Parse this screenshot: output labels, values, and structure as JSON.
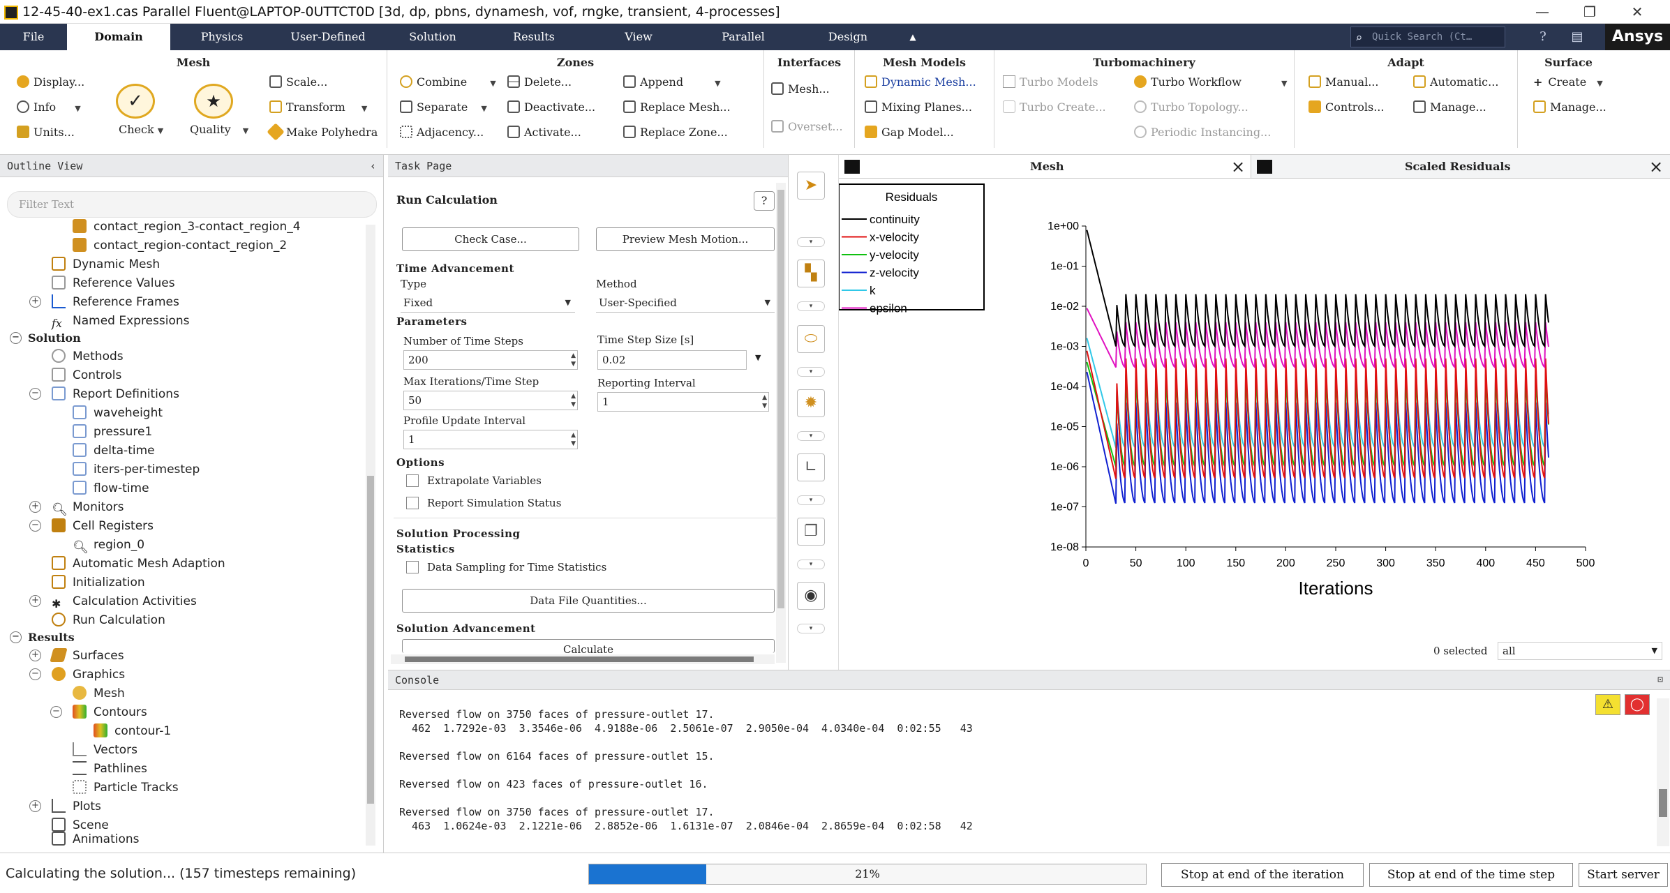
{
  "window": {
    "title": "12-45-40-ex1.cas Parallel Fluent@LAPTOP-0UTTCT0D  [3d, dp, pbns, dynamesh, vof, rngke, transient, 4-processes]"
  },
  "menu": {
    "tabs": [
      "File",
      "Domain",
      "Physics",
      "User-Defined",
      "Solution",
      "Results",
      "View",
      "Parallel",
      "Design"
    ],
    "active": "Domain",
    "search_placeholder": "Quick Search (Ct…",
    "brand": "Ansys"
  },
  "ribbon": {
    "mesh": {
      "title": "Mesh",
      "display": "Display...",
      "info": "Info",
      "units": "Units...",
      "check": "Check",
      "quality": "Quality",
      "scale": "Scale...",
      "transform": "Transform",
      "make_polyhedra": "Make Polyhedra"
    },
    "zones": {
      "title": "Zones",
      "combine": "Combine",
      "separate": "Separate",
      "adjacency": "Adjacency...",
      "delete": "Delete...",
      "deactivate": "Deactivate...",
      "activate": "Activate...",
      "append": "Append",
      "replace_mesh": "Replace Mesh...",
      "replace_zone": "Replace Zone..."
    },
    "interfaces": {
      "title": "Interfaces",
      "mesh": "Mesh...",
      "overset": "Overset..."
    },
    "mesh_models": {
      "title": "Mesh Models",
      "dynamic_mesh": "Dynamic Mesh...",
      "mixing_planes": "Mixing Planes...",
      "gap_model": "Gap Model..."
    },
    "turbomachinery": {
      "title": "Turbomachinery",
      "turbo_models": "Turbo Models",
      "turbo_workflow": "Turbo Workflow",
      "turbo_create": "Turbo Create...",
      "turbo_topology": "Turbo Topology...",
      "periodic_instancing": "Periodic Instancing..."
    },
    "adapt": {
      "title": "Adapt",
      "manual": "Manual...",
      "automatic": "Automatic...",
      "controls": "Controls...",
      "manage": "Manage..."
    },
    "surface": {
      "title": "Surface",
      "create": "Create",
      "manage": "Manage..."
    }
  },
  "outline": {
    "title": "Outline View",
    "filter_placeholder": "Filter Text",
    "items": [
      {
        "label": "contact_region_3-contact_region_4"
      },
      {
        "label": "contact_region-contact_region_2"
      },
      {
        "label": "Dynamic Mesh"
      },
      {
        "label": "Reference Values"
      },
      {
        "label": "Reference Frames"
      },
      {
        "label": "Named Expressions"
      },
      {
        "label": "Solution"
      },
      {
        "label": "Methods"
      },
      {
        "label": "Controls"
      },
      {
        "label": "Report Definitions"
      },
      {
        "label": "waveheight"
      },
      {
        "label": "pressure1"
      },
      {
        "label": "delta-time"
      },
      {
        "label": "iters-per-timestep"
      },
      {
        "label": "flow-time"
      },
      {
        "label": "Monitors"
      },
      {
        "label": "Cell Registers"
      },
      {
        "label": "region_0"
      },
      {
        "label": "Automatic Mesh Adaption"
      },
      {
        "label": "Initialization"
      },
      {
        "label": "Calculation Activities"
      },
      {
        "label": "Run Calculation"
      },
      {
        "label": "Results"
      },
      {
        "label": "Surfaces"
      },
      {
        "label": "Graphics"
      },
      {
        "label": "Mesh"
      },
      {
        "label": "Contours"
      },
      {
        "label": "contour-1"
      },
      {
        "label": "Vectors"
      },
      {
        "label": "Pathlines"
      },
      {
        "label": "Particle Tracks"
      },
      {
        "label": "Plots"
      },
      {
        "label": "Scene"
      },
      {
        "label": "Animations"
      }
    ]
  },
  "task": {
    "header": "Task Page",
    "title": "Run Calculation",
    "check_case": "Check Case...",
    "preview_mesh": "Preview Mesh Motion...",
    "time_advancement": "Time Advancement",
    "type_label": "Type",
    "type_value": "Fixed",
    "method_label": "Method",
    "method_value": "User-Specified",
    "parameters": "Parameters",
    "n_steps_label": "Number of Time Steps",
    "n_steps": "200",
    "step_size_label": "Time Step Size [s]",
    "step_size": "0.02",
    "max_iter_label": "Max Iterations/Time Step",
    "max_iter": "50",
    "report_interval_label": "Reporting Interval",
    "report_interval": "1",
    "profile_interval_label": "Profile Update Interval",
    "profile_interval": "1",
    "options": "Options",
    "extrapolate": "Extrapolate Variables",
    "report_status": "Report Simulation Status",
    "solution_processing": "Solution Processing",
    "statistics": "Statistics",
    "data_sampling": "Data Sampling for Time Statistics",
    "data_file_quantities": "Data File Quantities...",
    "solution_advancement": "Solution Advancement",
    "calculate": "Calculate"
  },
  "graphics": {
    "mesh_tab": "Mesh",
    "residuals_tab": "Scaled Residuals",
    "selected": "0 selected",
    "filter_value": "all"
  },
  "chart_data": {
    "type": "line",
    "title": "",
    "xlabel": "Iterations",
    "ylabel": "",
    "xlim": [
      0,
      500
    ],
    "ylim": [
      1e-08,
      1
    ],
    "yscale": "log",
    "xticks": [
      "0",
      "50",
      "100",
      "150",
      "200",
      "250",
      "300",
      "350",
      "400",
      "450",
      "500"
    ],
    "yticks": [
      "1e+00",
      "1e-01",
      "1e-02",
      "1e-03",
      "1e-04",
      "1e-05",
      "1e-06",
      "1e-07",
      "1e-08"
    ],
    "legend_title": "Residuals",
    "legend_position": "top-left",
    "series": [
      {
        "name": "continuity",
        "color": "#000000",
        "start": 1.0,
        "settle_at": 30,
        "peak": 0.02,
        "trough": 0.001
      },
      {
        "name": "x-velocity",
        "color": "#e01010",
        "start": 0.001,
        "settle_at": 30,
        "peak": 0.0005,
        "trough": 5e-07
      },
      {
        "name": "y-velocity",
        "color": "#10c010",
        "start": 0.0005,
        "settle_at": 30,
        "peak": 0.0002,
        "trough": 1e-06
      },
      {
        "name": "z-velocity",
        "color": "#1020d0",
        "start": 0.0003,
        "settle_at": 30,
        "peak": 4e-05,
        "trough": 1.2e-07
      },
      {
        "name": "k",
        "color": "#30c8e8",
        "start": 0.002,
        "settle_at": 30,
        "peak": 0.0002,
        "trough": 3e-06
      },
      {
        "name": "epsilon",
        "color": "#e010c0",
        "start": 0.01,
        "settle_at": 30,
        "peak": 0.004,
        "trough": 0.0003
      }
    ],
    "cycle_length": 10,
    "last_iteration": 463
  },
  "console": {
    "title": "Console",
    "lines": [
      "Reversed flow on 3750 faces of pressure-outlet 17.",
      "  462  1.7292e-03  3.3546e-06  4.9188e-06  2.5061e-07  2.9050e-04  4.0340e-04  0:02:55   43",
      "",
      "Reversed flow on 6164 faces of pressure-outlet 15.",
      "",
      "Reversed flow on 423 faces of pressure-outlet 16.",
      "",
      "Reversed flow on 3750 faces of pressure-outlet 17.",
      "  463  1.0624e-03  2.1221e-06  2.8852e-06  1.6131e-07  2.0846e-04  2.8659e-04  0:02:58   42"
    ]
  },
  "status": {
    "text": "Calculating the solution... (157 timesteps remaining)",
    "progress_label": "21%",
    "progress": 0.21,
    "stop_iteration": "Stop at end of the iteration",
    "stop_timestep": "Stop at end of the time step",
    "start_server": "Start server"
  }
}
